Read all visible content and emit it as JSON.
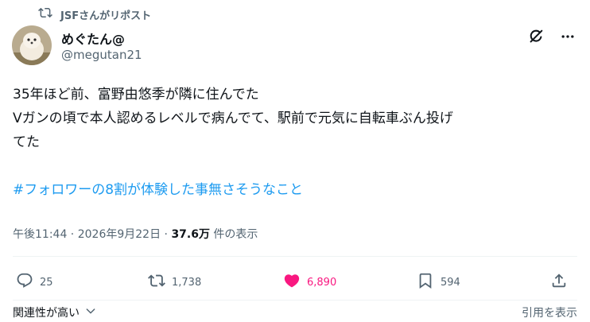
{
  "repost": {
    "label": "JSFさんがリポスト"
  },
  "author": {
    "display_name": "めぐたん@",
    "handle": "@megutan21"
  },
  "tweet": {
    "lines": [
      "35年ほど前、富野由悠季が隣に住んでた",
      "Vガンの頃で本人認めるレベルで病んでて、駅前で元気に自転車ぶん投げ",
      "てた"
    ],
    "hashtag": "#フォロワーの8割が体験した事無さそうなこと"
  },
  "meta": {
    "time": "午後11:44",
    "separator": " · ",
    "date": "2026年9月22日",
    "views_count": "37.6万",
    "views_label": " 件の表示"
  },
  "actions": {
    "replies": "25",
    "reposts": "1,738",
    "likes": "6,890",
    "bookmarks": "594"
  },
  "footer": {
    "sort_label": "関連性が高い",
    "quotes_label": "引用を表示"
  },
  "colors": {
    "accent": "#1d9bf0",
    "like": "#f91880",
    "secondary_text": "#536471"
  },
  "icons": {
    "repost": "repost-icon",
    "grok": "grok-icon",
    "more": "more-icon",
    "reply": "reply-icon",
    "like": "heart-filled-icon",
    "bookmark": "bookmark-icon",
    "share": "share-icon",
    "chevron": "chevron-down-icon"
  }
}
